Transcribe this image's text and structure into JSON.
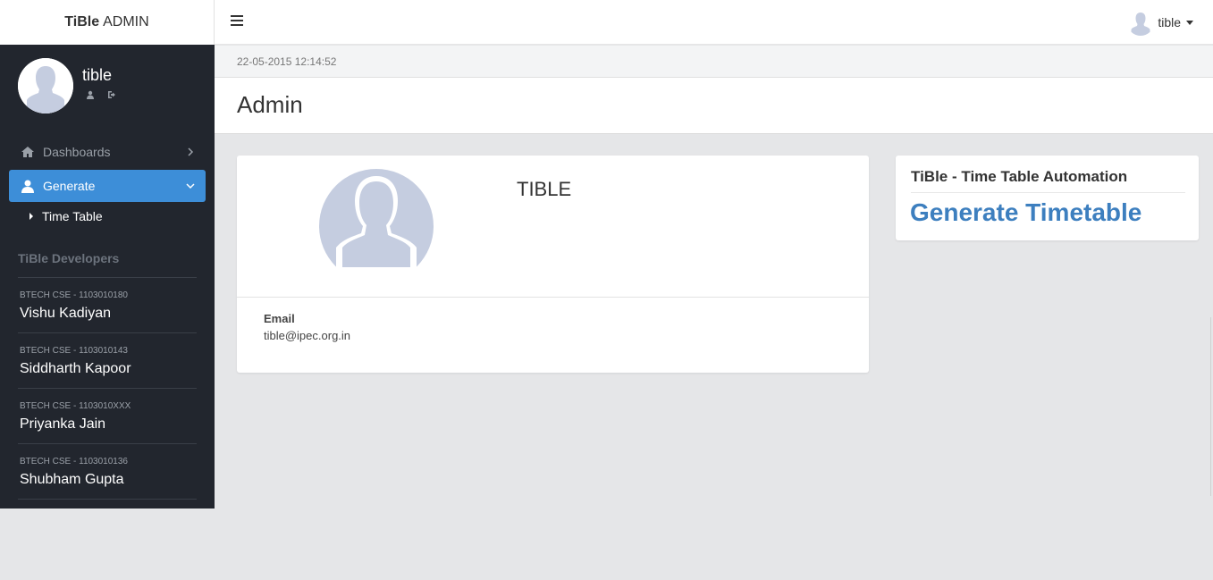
{
  "brand": {
    "bold": "TiBle",
    "light": "ADMIN"
  },
  "sidebar": {
    "user_name": "tible",
    "nav": [
      {
        "label": "Dashboards",
        "icon": "home-icon",
        "expanded": false
      },
      {
        "label": "Generate",
        "icon": "user-icon",
        "expanded": true,
        "active": true
      }
    ],
    "sub_items": [
      {
        "label": "Time Table"
      }
    ],
    "developers_heading": "TiBle Developers",
    "developers": [
      {
        "roll": "BTECH CSE - 1103010180",
        "name": "Vishu Kadiyan"
      },
      {
        "roll": "BTECH CSE - 1103010143",
        "name": "Siddharth Kapoor"
      },
      {
        "roll": "BTECH CSE - 1103010XXX",
        "name": "Priyanka Jain"
      },
      {
        "roll": "BTECH CSE - 1103010136",
        "name": "Shubham Gupta"
      }
    ]
  },
  "topbar": {
    "user_name": "tible"
  },
  "datetime": "22-05-2015 12:14:52",
  "page_title": "Admin",
  "profile": {
    "name": "TIBLE",
    "email_label": "Email",
    "email": "tible@ipec.org.in"
  },
  "app_card": {
    "title": "TiBle - Time Table Automation",
    "link": "Generate Timetable"
  },
  "colors": {
    "sidebar_bg": "#22262e",
    "active_nav": "#3d8ed8",
    "link_blue": "#3d7fbf",
    "content_bg": "#e5e6e8"
  }
}
